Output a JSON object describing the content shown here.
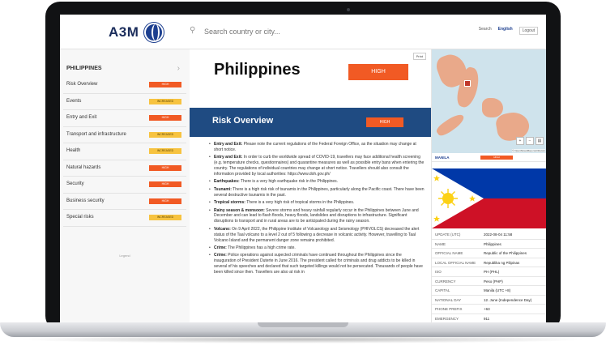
{
  "header": {
    "logo_text": "A3M",
    "search_placeholder": "Search country or city...",
    "links": [
      "Search",
      "English",
      "Logout"
    ]
  },
  "sidebar": {
    "title": "PHILIPPINES",
    "items": [
      {
        "label": "Risk Overview",
        "level": "HIGH"
      },
      {
        "label": "Events",
        "level": "INCREASED"
      },
      {
        "label": "Entry and Exit",
        "level": "HIGH"
      },
      {
        "label": "Transport and infrastructure",
        "level": "INCREASED"
      },
      {
        "label": "Health",
        "level": "INCREASED"
      },
      {
        "label": "Natural hazards",
        "level": "HIGH"
      },
      {
        "label": "Security",
        "level": "HIGH"
      },
      {
        "label": "Business security",
        "level": "HIGH"
      },
      {
        "label": "Special risks",
        "level": "INCREASED"
      }
    ],
    "legend": "Legend"
  },
  "main": {
    "print_label": "Print",
    "country": "Philippines",
    "level": "HIGH",
    "section_title": "Risk Overview",
    "section_level": "HIGH",
    "bullets": [
      {
        "title": "Entry and Exit:",
        "text": " Please note the current regulations of the Federal Foreign Office, as the situation may change at short notice."
      },
      {
        "title": "Entry and Exit:",
        "text": " In order to curb the worldwide spread of COVID-19, travellers may face additional health screening (e.g. temperature checks, questionnaires) and quarantine measures as well as possible entry bans when entering the country. The regulations of individual countries may change at short notice. Travellers should also consult the information provided by local authorities: https://www.doh.gov.ph/"
      },
      {
        "title": "Earthquakes:",
        "text": " There is a very high earthquake risk in the Philippines."
      },
      {
        "title": "Tsunami:",
        "text": " There is a high risk risk of tsunamis in the Philippines, particularly along the Pacific coast. There have been several destructive tsunamis in the past."
      },
      {
        "title": "Tropical storms:",
        "text": " There is a very high risk of tropical storms in the Philippines."
      },
      {
        "title": "Rainy season & monsoon:",
        "text": " Severe storms and heavy rainfall regularly occur in the Philippines between June and December and can lead to flash floods, heavy floods, landslides and disruptions to infrastructure. Significant disruptions to transport and in rural areas are to be anticipated during the rainy season."
      },
      {
        "title": "Volcano:",
        "text": " On 9 April 2022, the Philippine Institute of Volcanology and Seismology (PHIVOLCS) decreased the alert status of the Taal volcano to a level 2 out of 5 following a decrease in volcanic activity. However, travelling to Taal Volcano Island and the permanent danger zone remains prohibited."
      },
      {
        "title": "Crime:",
        "text": " The Philippines has a high crime rate."
      },
      {
        "title": "Crime:",
        "text": " Police operations against supected criminals have continued throughout the Philippines since the inauguration of President Duterte in June 2016. The president called for criminals and drug addicts to be killed in several of his speeches and declared that such targeted killings would not be persecuted. Thousands of people have been killed since then. Travellers are also at risk in"
      }
    ]
  },
  "right": {
    "map_credit": "© OpenStreetMap contributors",
    "city": "MANILA",
    "city_level": "HIGH",
    "info": [
      {
        "key": "UPDATE (UTC)",
        "value": "2022-08-04 11:58"
      },
      {
        "key": "NAME",
        "value": "Philippines"
      },
      {
        "key": "OFFICIAL NAME",
        "value": "Republic of the Philippines"
      },
      {
        "key": "LOCAL OFFICIAL NAME",
        "value": "Republika ng Pilipinas"
      },
      {
        "key": "ISO",
        "value": "PH (PHL)"
      },
      {
        "key": "CURRENCY",
        "value": "Peso (PHP)"
      },
      {
        "key": "CAPITAL",
        "value": "Manila (UTC +8)"
      },
      {
        "key": "NATIONAL DAY",
        "value": "12. June (Independence Day)"
      },
      {
        "key": "PHONE PREFIX",
        "value": "+63"
      },
      {
        "key": "EMERGENCY",
        "value": "911"
      }
    ]
  },
  "colors": {
    "high": "#f15a24",
    "increased": "#f7c340",
    "brand_blue": "#1f4b82"
  }
}
